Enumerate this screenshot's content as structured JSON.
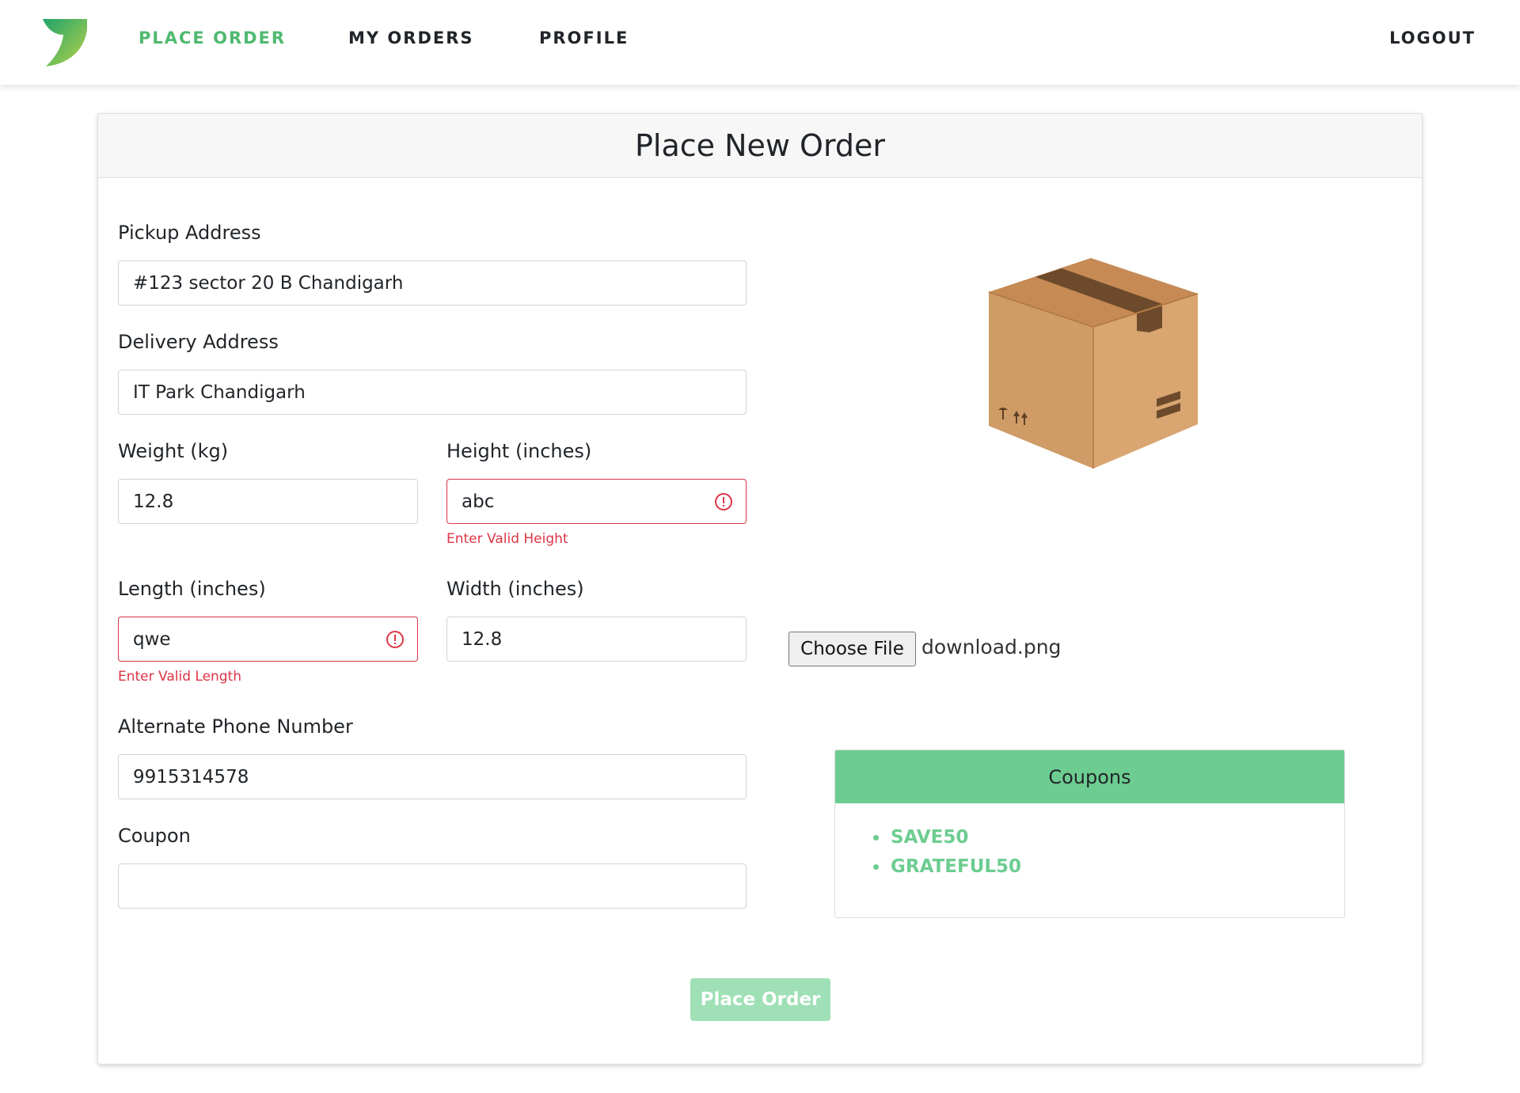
{
  "nav": {
    "place_order": "PLACE ORDER",
    "my_orders": "MY ORDERS",
    "profile": "PROFILE",
    "logout": "LOGOUT",
    "active": "place_order",
    "accent_color": "#4fb96f"
  },
  "card": {
    "title": "Place New Order"
  },
  "form": {
    "pickup": {
      "label": "Pickup Address",
      "value": "#123 sector 20 B Chandigarh"
    },
    "delivery": {
      "label": "Delivery Address",
      "value": "IT Park Chandigarh"
    },
    "weight": {
      "label": "Weight (kg)",
      "value": "12.8"
    },
    "height": {
      "label": "Height (inches)",
      "value": "abc",
      "error": "Enter Valid Height"
    },
    "length": {
      "label": "Length (inches)",
      "value": "qwe",
      "error": "Enter Valid Length"
    },
    "width": {
      "label": "Width (inches)",
      "value": "12.8"
    },
    "phone": {
      "label": "Alternate Phone Number",
      "value": "9915314578"
    },
    "coupon": {
      "label": "Coupon",
      "value": ""
    },
    "submit_label": "Place Order"
  },
  "upload": {
    "button_label": "Choose File",
    "file_name": "download.png"
  },
  "coupons_panel": {
    "title": "Coupons",
    "items": [
      "SAVE50",
      "GRATEFUL50"
    ],
    "header_color": "#6dcd91"
  },
  "colors": {
    "error": "#dc3545",
    "submit_disabled": "#9fe0b6"
  }
}
